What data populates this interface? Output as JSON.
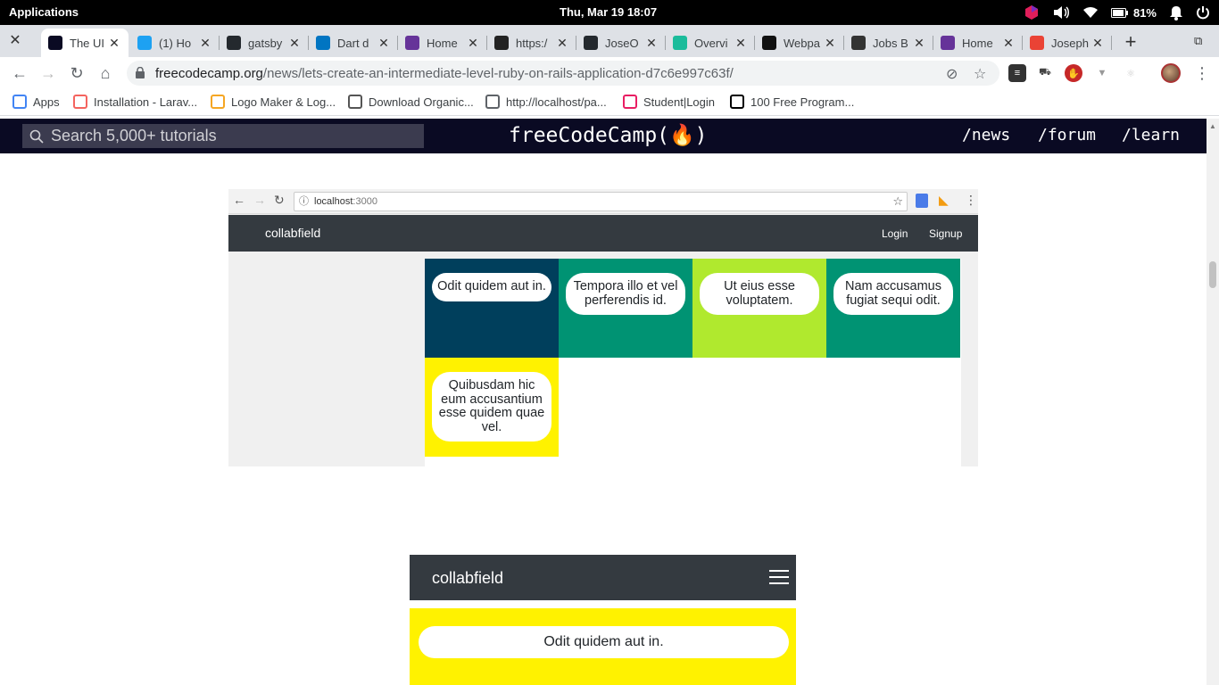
{
  "system_bar": {
    "apps_label": "Applications",
    "datetime": "Thu, Mar 19    18:07",
    "battery": "81%"
  },
  "tabs": [
    {
      "title": "The UI",
      "favicon": "fcc-icon",
      "color": "#0a0a23",
      "active": true
    },
    {
      "title": "(1) Ho",
      "favicon": "twitter-icon",
      "color": "#1da1f2"
    },
    {
      "title": "gatsby",
      "favicon": "github-icon",
      "color": "#24292e"
    },
    {
      "title": "Dart d",
      "favicon": "dart-icon",
      "color": "#0175c2"
    },
    {
      "title": "Home",
      "favicon": "gatsby-icon",
      "color": "#663399"
    },
    {
      "title": "https:/",
      "favicon": "person-icon",
      "color": "#222222"
    },
    {
      "title": "JoseO",
      "favicon": "github-icon",
      "color": "#24292e"
    },
    {
      "title": "Overvi",
      "favicon": "diamond-icon",
      "color": "#1bbc9b"
    },
    {
      "title": "Webpa",
      "favicon": "cm-icon",
      "color": "#111111"
    },
    {
      "title": "Jobs B",
      "favicon": "star-icon",
      "color": "#333333"
    },
    {
      "title": "Home",
      "favicon": "gatsby-icon",
      "color": "#663399"
    },
    {
      "title": "Joseph",
      "favicon": "google-icon",
      "color": "#ea4335"
    }
  ],
  "omnibox": {
    "host": "freecodecamp.org",
    "path": "/news/lets-create-an-intermediate-level-ruby-on-rails-application-d7c6e997c63f/"
  },
  "bookmarks": [
    {
      "label": "Apps",
      "icon": "apps-grid-icon",
      "color": "#4285f4"
    },
    {
      "label": "Installation - Larav...",
      "icon": "laravel-icon",
      "color": "#f4645f"
    },
    {
      "label": "Logo Maker & Log...",
      "icon": "logo-maker-icon",
      "color": "#f5a623"
    },
    {
      "label": "Download Organic...",
      "icon": "w3-icon",
      "color": "#555555"
    },
    {
      "label": "http://localhost/pa...",
      "icon": "globe-icon",
      "color": "#5f6368"
    },
    {
      "label": "Student|Login",
      "icon": "student-icon",
      "color": "#e91e63"
    },
    {
      "label": "100 Free Program...",
      "icon": "dev-icon",
      "color": "#000000"
    }
  ],
  "fcc": {
    "search_placeholder": "Search 5,000+ tutorials",
    "logo": "freeCodeCamp(🔥)",
    "links": [
      "/news",
      "/forum",
      "/learn"
    ]
  },
  "screenshot1": {
    "url": "localhost",
    "port": ":3000",
    "brand": "collabfield",
    "login": "Login",
    "signup": "Signup",
    "posts": [
      {
        "text": "Odit quidem aut in.",
        "color": "#003f5c"
      },
      {
        "text": "Tempora illo et vel perferendis id.",
        "color": "#009373"
      },
      {
        "text": "Ut eius esse voluptatem.",
        "color": "#b0e92e"
      },
      {
        "text": "Nam accusamus fugiat sequi odit.",
        "color": "#009373"
      },
      {
        "text": "Quibusdam hic eum accusantium esse quidem quae vel.",
        "color": "#fff200"
      }
    ]
  },
  "screenshot2": {
    "brand": "collabfield",
    "post": "Odit quidem aut in."
  }
}
